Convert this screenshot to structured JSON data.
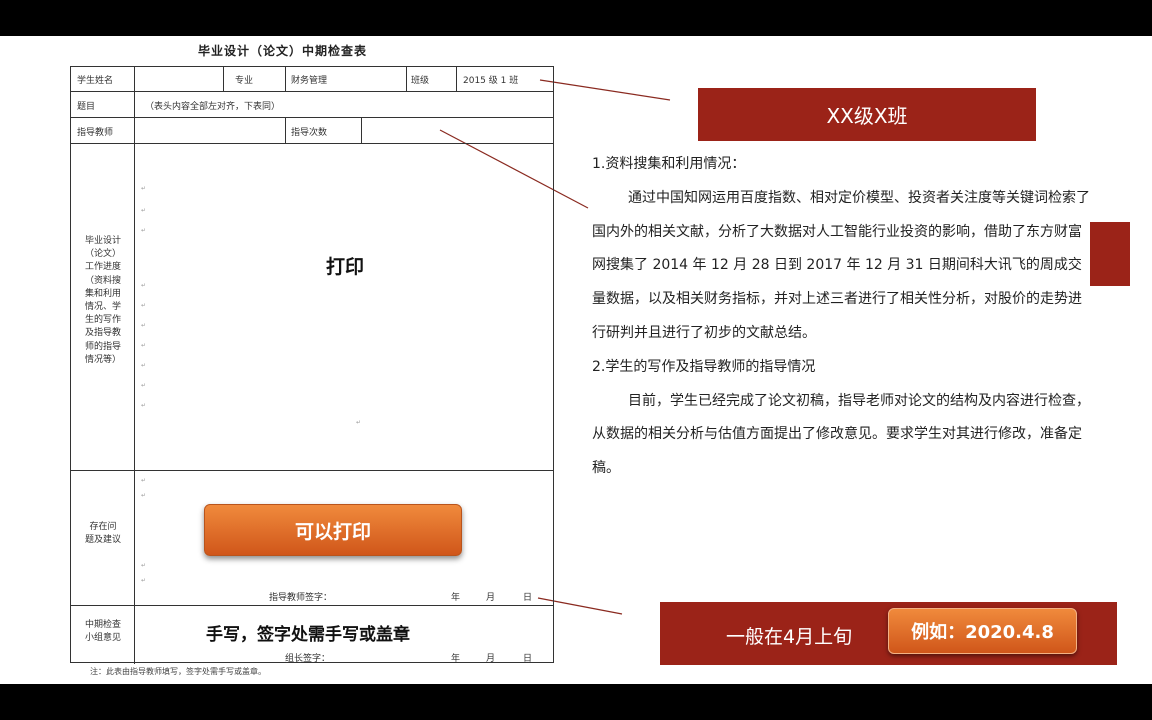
{
  "form": {
    "title": "毕业设计（论文）中期检查表",
    "labels": {
      "student_name": "学生姓名",
      "major": "专业",
      "major_value": "财务管理",
      "class": "班级",
      "class_value": "2015 级 1 班",
      "topic": "题目",
      "topic_hint": "（表头内容全部左对齐，下表同）",
      "advisor": "指导教师",
      "guide_count": "指导次数",
      "progress_lines": [
        "毕业设计",
        "（论文）",
        "工作进度",
        "（资料搜",
        "集和利用",
        "情况、学",
        "生的写作",
        "及指导教",
        "师的指导",
        "情况等）"
      ],
      "issues_lines": [
        "存在问",
        "题及建议"
      ],
      "advisor_sign": "指导教师签字：",
      "year": "年",
      "month": "月",
      "day": "日",
      "mid_check_lines": [
        "中期检查",
        "小组意见"
      ],
      "leader_sign": "组长签字："
    },
    "footnote": "注：此表由指导教师填写，签字处需手写或盖章。"
  },
  "overlays": {
    "print_label": "打印",
    "print_button": "可以打印",
    "handwrite_note": "手写，签字处需手写或盖章"
  },
  "banners": {
    "class_banner": "XX级X班",
    "date_banner": "一般在4月上旬",
    "example_button": "例如：2020.4.8"
  },
  "document": {
    "heading1": "1.资料搜集和利用情况：",
    "para1": "通过中国知网运用百度指数、相对定价模型、投资者关注度等关键词检索了国内外的相关文献，分析了大数据对人工智能行业投资的影响，借助了东方财富网搜集了 2014 年 12 月 28 日到 2017 年 12 月 31 日期间科大讯飞的周成交量数据，以及相关财务指标，并对上述三者进行了相关性分析，对股价的走势进行研判并且进行了初步的文献总结。",
    "heading2": "2.学生的写作及指导教师的指导情况",
    "para2": "目前，学生已经完成了论文初稿，指导老师对论文的结构及内容进行检查，从数据的相关分析与估值方面提出了修改意见。要求学生对其进行修改，准备定稿。"
  },
  "colors": {
    "banner": "#9b2318",
    "button_orange": "#e06e2a",
    "letterbox": "#000000"
  }
}
